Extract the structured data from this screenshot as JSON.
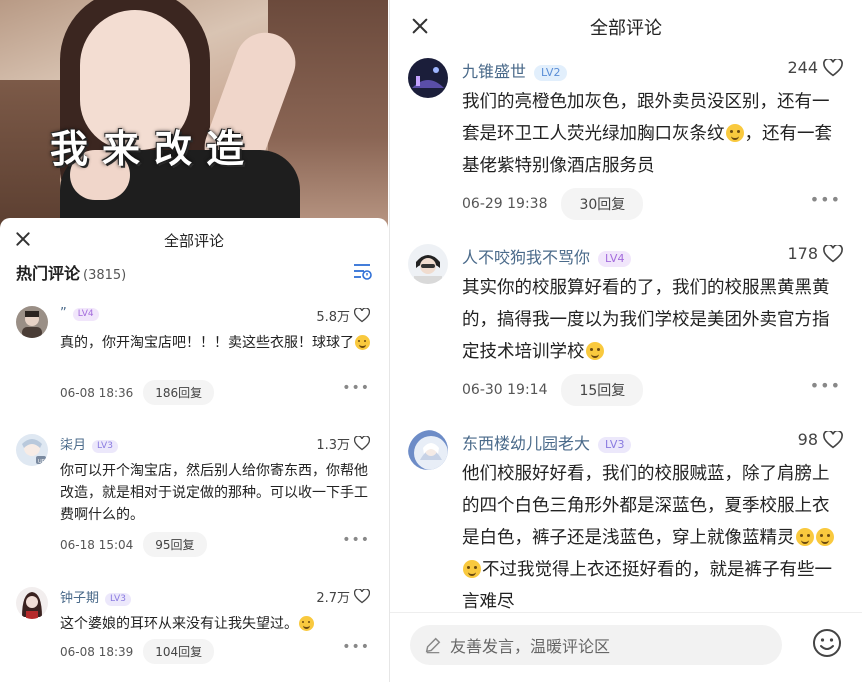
{
  "video": {
    "overlay_text": "我来改造"
  },
  "left": {
    "title": "全部评论",
    "hot_label": "热门评论",
    "hot_count": "(3815)",
    "comments": [
      {
        "name": "”",
        "level": "LV4",
        "likes": "5.8万",
        "text": "真的，你开淘宝店吧！！！卖这些衣服！球球了",
        "date": "06-08 18:36",
        "reply": "186回复"
      },
      {
        "name": "柒月",
        "level": "LV3",
        "likes": "1.3万",
        "text": "你可以开个淘宝店，然后别人给你寄东西，你帮他改造，就是相对于说定做的那种。可以收一下手工费啊什么的。",
        "date": "06-18 15:04",
        "reply": "95回复"
      },
      {
        "name": "钟子期",
        "level": "LV3",
        "likes": "2.7万",
        "text": "这个婆娘的耳环从来没有让我失望过。",
        "date": "06-08 18:39",
        "reply": "104回复"
      }
    ]
  },
  "right": {
    "title": "全部评论",
    "comments": [
      {
        "name": "九锥盛世",
        "level": "LV2",
        "likes": "244",
        "text": "我们的亮橙色加灰色，跟外卖员没区别，还有一套是环卫工人荧光绿加胸口灰条纹",
        "text2": "，还有一套基佬紫特别像酒店服务员",
        "date": "06-29 19:38",
        "reply": "30回复"
      },
      {
        "name": "人不咬狗我不骂你",
        "level": "LV4",
        "likes": "178",
        "text": "其实你的校服算好看的了，我们的校服黑黄黑黄的，搞得我一度以为我们学校是美团外卖官方指定技术培训学校",
        "date": "06-30 19:14",
        "reply": "15回复"
      },
      {
        "name": "东西楼幼儿园老大",
        "level": "LV3",
        "likes": "98",
        "text": "他们校服好好看，我们的校服贼蓝，除了肩膀上的四个白色三角形外都是深蓝色，夏季校服上衣是白色，裤子还是浅蓝色，穿上就像蓝精灵",
        "text2": "不过我觉得上衣还挺好看的，就是裤子有些一言难尽"
      }
    ],
    "input_placeholder": "友善发言，温暖评论区"
  }
}
